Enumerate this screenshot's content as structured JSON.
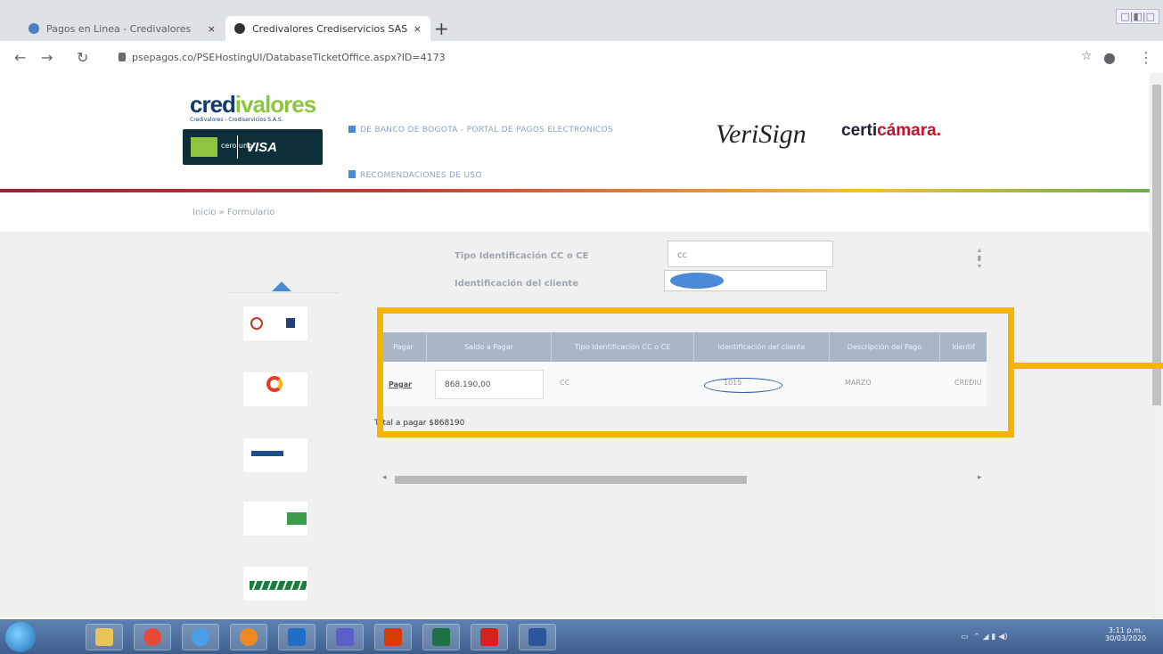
{
  "browser": {
    "tabs": [
      {
        "title": "Pagos en Linea - Credivalores"
      },
      {
        "title": "Credivalores Crediservicios SAS"
      }
    ],
    "new_tab": "+",
    "close": "×",
    "url": "psepagos.co/PSEHostingUI/DatabaseTicketOffice.aspx?ID=4173",
    "window_controls": "□|◧|□"
  },
  "header": {
    "brand": "credivalores",
    "brand_sub": "Credivalores - Crediservicios S.A.S.",
    "card_left": "cero uno",
    "card_right": "VISA",
    "link1": "DE BANCO DE BOGOTA - PORTAL DE PAGOS ELECTRONICOS",
    "link2": "RECOMENDACIONES DE USO",
    "verisign": "VeriSign",
    "certicamara_a": "certi",
    "certicamara_b": "cámara."
  },
  "breadcrumb": "Inicio » Formulario",
  "form": {
    "tipo_label": "Tipo Identificación CC o CE",
    "tipo_value": "cc",
    "id_label": "Identificación del cliente"
  },
  "table": {
    "headers": [
      "Pagar",
      "Saldo a Pagar",
      "Tipo Identificación CC o CE",
      "Identificación del cliente",
      "Descripción del Pago",
      "Identif"
    ],
    "row": {
      "pagar": "Pagar",
      "saldo": "868.190,00",
      "tipo": "CC",
      "identificacion": "1015",
      "descripcion": "MARZO",
      "extra": "CREDIU"
    },
    "total": "Total a pagar  $868190"
  },
  "taskbar": {
    "clock_time": "3:11 p.m.",
    "clock_date": "30/03/2020"
  },
  "colors": {
    "highlight": "#f5b400",
    "brand_blue": "#123a6e",
    "brand_green": "#8cc63f"
  }
}
